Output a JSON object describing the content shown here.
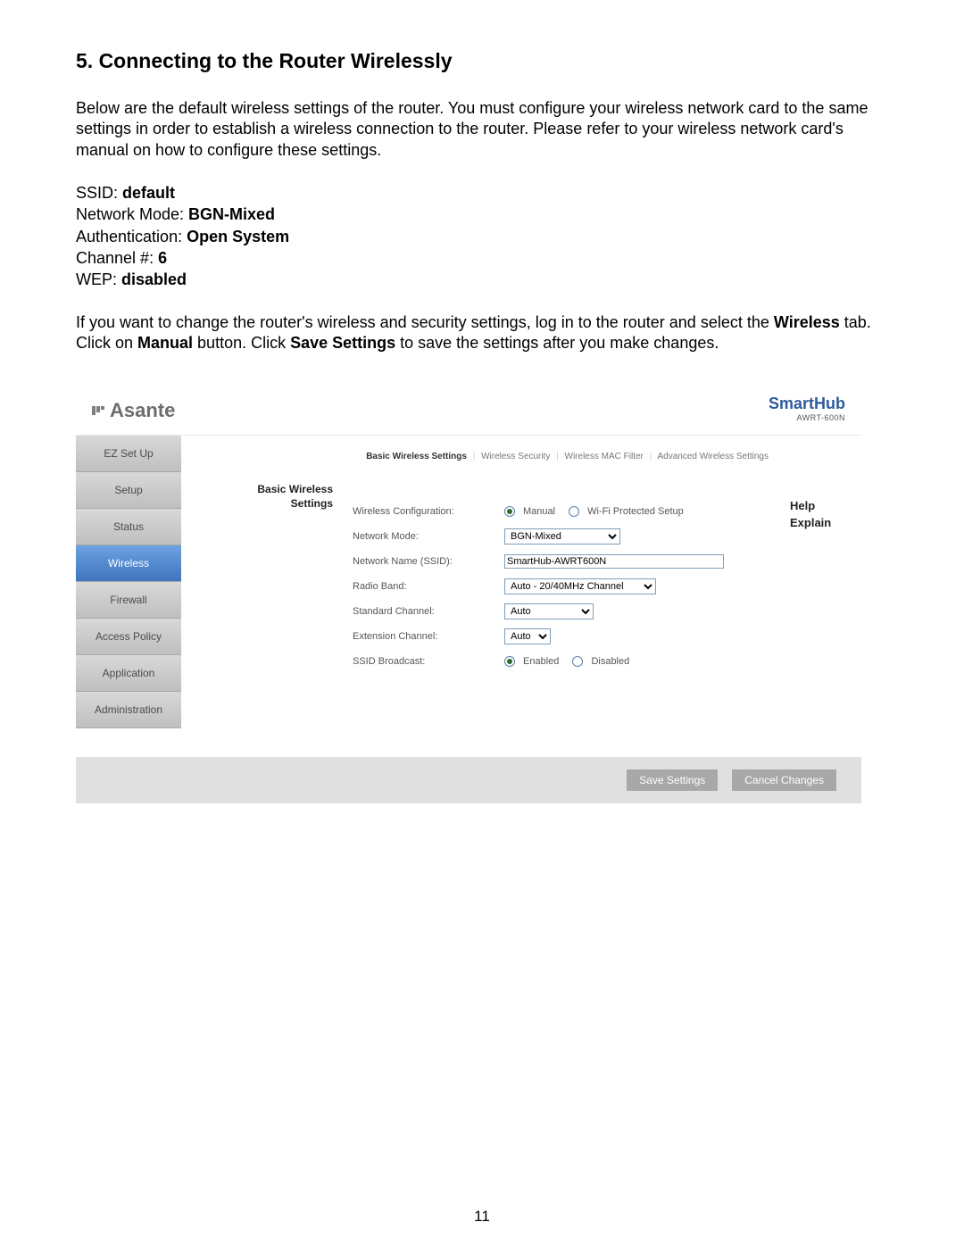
{
  "heading": "5. Connecting to the Router Wirelessly",
  "intro": "Below are the default wireless settings of the router. You must configure your wireless network card to the same settings in order to establish a wireless connection to the router. Please refer to your wireless network card's manual on how to configure these settings.",
  "defaults": {
    "ssid_label": "SSID: ",
    "ssid_value": "default",
    "mode_label": "Network Mode: ",
    "mode_value": "BGN-Mixed",
    "auth_label": "Authentication: ",
    "auth_value": "Open System",
    "channel_label": "Channel #: ",
    "channel_value": "6",
    "wep_label": "WEP: ",
    "wep_value": "disabled"
  },
  "instructions": {
    "pre": "If you want to change the router's wireless and security settings, log in to the router and select the ",
    "tab": "Wireless",
    "mid1": " tab.  Click on ",
    "manual": "Manual",
    "mid2": " button. Click ",
    "save": "Save Settings",
    "post": " to save the settings after you make changes."
  },
  "router": {
    "brand": "Asante",
    "product": "SmartHub",
    "model": "AWRT-600N",
    "nav": [
      "EZ Set Up",
      "Setup",
      "Status",
      "Wireless",
      "Firewall",
      "Access Policy",
      "Application",
      "Administration"
    ],
    "nav_active_index": 3,
    "tabs": [
      "Basic Wireless Settings",
      "Wireless Security",
      "Wireless MAC Filter",
      "Advanced Wireless Settings"
    ],
    "tabs_active_index": 0,
    "section_title": "Basic Wireless Settings",
    "help": "Help Explain",
    "fields": {
      "wireless_configuration_label": "Wireless Configuration:",
      "wireless_configuration_manual": "Manual",
      "wireless_configuration_wps": "Wi-Fi Protected Setup",
      "network_mode_label": "Network Mode:",
      "network_mode_value": "BGN-Mixed",
      "ssid_label": "Network Name (SSID):",
      "ssid_value": "SmartHub-AWRT600N",
      "radio_band_label": "Radio Band:",
      "radio_band_value": "Auto - 20/40MHz Channel",
      "std_channel_label": "Standard Channel:",
      "std_channel_value": "Auto",
      "ext_channel_label": "Extension Channel:",
      "ext_channel_value": "Auto",
      "ssid_broadcast_label": "SSID Broadcast:",
      "ssid_broadcast_enabled": "Enabled",
      "ssid_broadcast_disabled": "Disabled"
    },
    "buttons": {
      "save": "Save Settings",
      "cancel": "Cancel Changes"
    }
  },
  "page_number": "11"
}
